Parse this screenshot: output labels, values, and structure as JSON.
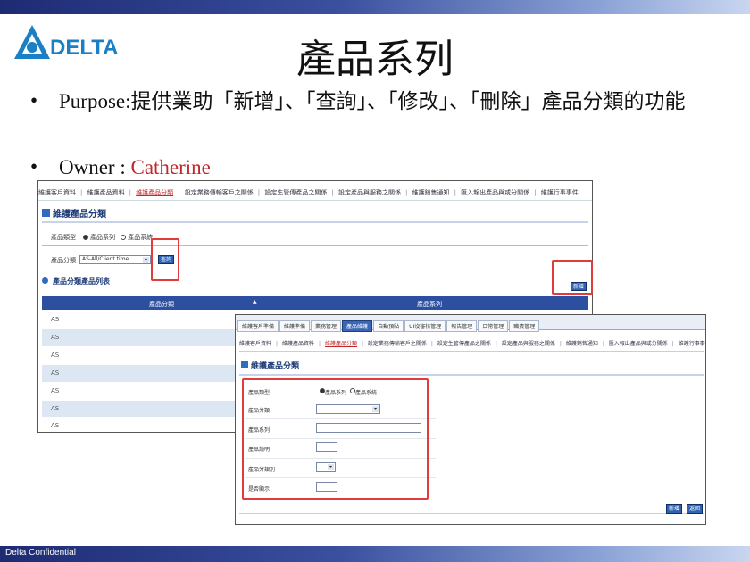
{
  "slide": {
    "title": "產品系列",
    "bullets": [
      {
        "marker": "•",
        "text": "Purpose:提供業助「新增」、「查詢」、「修改」、「刪除」產品分類的功能"
      },
      {
        "marker": "•",
        "label": "Owner : ",
        "value": "Catherine"
      }
    ],
    "footer": "Delta Confidential",
    "logo_text": "DELTA",
    "logo_icon": "delta-triangle-icon"
  },
  "colors": {
    "accent": "#1a7fc4",
    "owner": "#c0282a",
    "highlight": "#e03c3c",
    "grid_header": "#2d4fa0"
  },
  "screen1": {
    "tabs": [
      "維護客戶資料",
      "維護產品資料",
      "維護產品分類",
      "設定業務傳輸客戶之關係",
      "設定生管傳產品之關係",
      "設定產品與服務之關係",
      "維護銷售通知",
      "匯入報出產品與或分關係",
      "維護行事事件"
    ],
    "active_tab_index": 2,
    "page_title": "維護產品分類",
    "filter_label": "產品類型",
    "radio_options": [
      "產品系列",
      "產品系統"
    ],
    "category_label": "產品分類",
    "category_value": "AS-All/Client time",
    "query_button": "查詢",
    "add_button": "新增",
    "list_title": "產品分類產品列表",
    "columns": [
      "產品分類",
      "產品系列"
    ],
    "rows": [
      "AS",
      "AS",
      "AS",
      "AS",
      "AS",
      "AS",
      "AS"
    ]
  },
  "screen2": {
    "tabs": [
      "維護客戶準備",
      "維護準備",
      "業務管理",
      "產品維護",
      "自動預貼",
      "UI沒審核管理",
      "報告管理",
      "日常管理",
      "職責管理"
    ],
    "active_tab_index": 3,
    "links": [
      "維護客戶資料",
      "維護產品資料",
      "維護產品分類",
      "設定業務傳輸客戶之關係",
      "設定生管傳產品之關係",
      "設定產品與服務之關係",
      "維護銷售通知",
      "匯入報出產品與或分關係",
      "維護行事事件"
    ],
    "active_link_index": 2,
    "page_title": "維護產品分類",
    "fields": [
      "產品類型",
      "產品分類",
      "產品系列",
      "產品說明",
      "產品分類別",
      "是否顯示"
    ],
    "radio_options": [
      "產品系列",
      "產品系統"
    ],
    "buttons": [
      "新增",
      "返回"
    ]
  }
}
